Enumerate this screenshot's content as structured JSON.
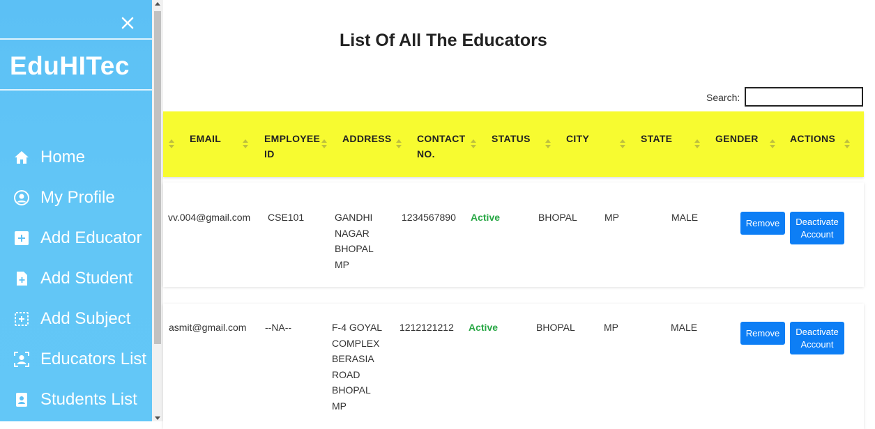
{
  "sidebar": {
    "brand": "EduHITec",
    "close_icon": "close-icon",
    "items": [
      {
        "label": "Home",
        "icon": "home-icon"
      },
      {
        "label": "My Profile",
        "icon": "user-circle-icon"
      },
      {
        "label": "Add Educator",
        "icon": "plus-square-icon"
      },
      {
        "label": "Add Student",
        "icon": "file-plus-icon"
      },
      {
        "label": "Add Subject",
        "icon": "dashed-plus-icon"
      },
      {
        "label": "Educators List",
        "icon": "user-scan-icon"
      },
      {
        "label": "Students List",
        "icon": "user-badge-icon"
      }
    ]
  },
  "main": {
    "title": "List Of All The Educators",
    "search": {
      "label": "Search:",
      "value": ""
    },
    "columns": [
      "EMAIL",
      "EMPLOYEE ID",
      "ADDRESS",
      "CONTACT NO.",
      "STATUS",
      "CITY",
      "STATE",
      "GENDER",
      "ACTIONS"
    ],
    "rows": [
      {
        "email": "vv.004@gmail.com",
        "employee_id": "CSE101",
        "address": [
          "GANDHI",
          "NAGAR",
          "BHOPAL",
          "MP"
        ],
        "contact": "1234567890",
        "status": "Active",
        "city": "BHOPAL",
        "state": "MP",
        "gender": "MALE",
        "remove_label": "Remove",
        "deactivate_label": "Deactivate Account"
      },
      {
        "email": "asmit@gmail.com",
        "employee_id": "--NA--",
        "address": [
          "F-4 GOYAL",
          "COMPLEX",
          "BERASIA",
          "ROAD",
          "BHOPAL",
          "MP"
        ],
        "contact": "1212121212",
        "status": "Active",
        "city": "BHOPAL",
        "state": "MP",
        "gender": "MALE",
        "remove_label": "Remove",
        "deactivate_label": "Deactivate Account"
      }
    ]
  },
  "colors": {
    "sidebar": "#5cc0f5",
    "header_row": "#f7fb30",
    "status_active": "#28a745",
    "button": "#0d7ef5"
  }
}
